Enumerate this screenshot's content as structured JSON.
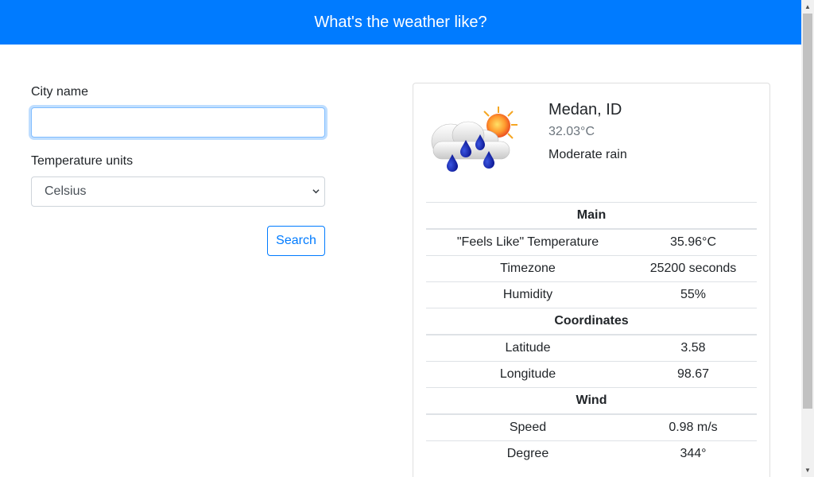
{
  "header": {
    "title": "What's the weather like?"
  },
  "form": {
    "city_label": "City name",
    "city_value": "",
    "units_label": "Temperature units",
    "units_selected": "Celsius",
    "search_label": "Search"
  },
  "weather": {
    "icon": "rain-cloud-sun-icon",
    "city": "Medan, ID",
    "temperature": "32.03°C",
    "description": "Moderate rain",
    "sections": [
      {
        "title": "Main",
        "rows": [
          {
            "label": "\"Feels Like\" Temperature",
            "value": "35.96°C"
          },
          {
            "label": "Timezone",
            "value": "25200 seconds"
          },
          {
            "label": "Humidity",
            "value": "55%"
          }
        ]
      },
      {
        "title": "Coordinates",
        "rows": [
          {
            "label": "Latitude",
            "value": "3.58"
          },
          {
            "label": "Longitude",
            "value": "98.67"
          }
        ]
      },
      {
        "title": "Wind",
        "rows": [
          {
            "label": "Speed",
            "value": "0.98 m/s"
          },
          {
            "label": "Degree",
            "value": "344°"
          }
        ]
      }
    ]
  },
  "colors": {
    "primary": "#007bff",
    "text": "#212529",
    "muted": "#6c757d",
    "border": "#dee2e6"
  }
}
